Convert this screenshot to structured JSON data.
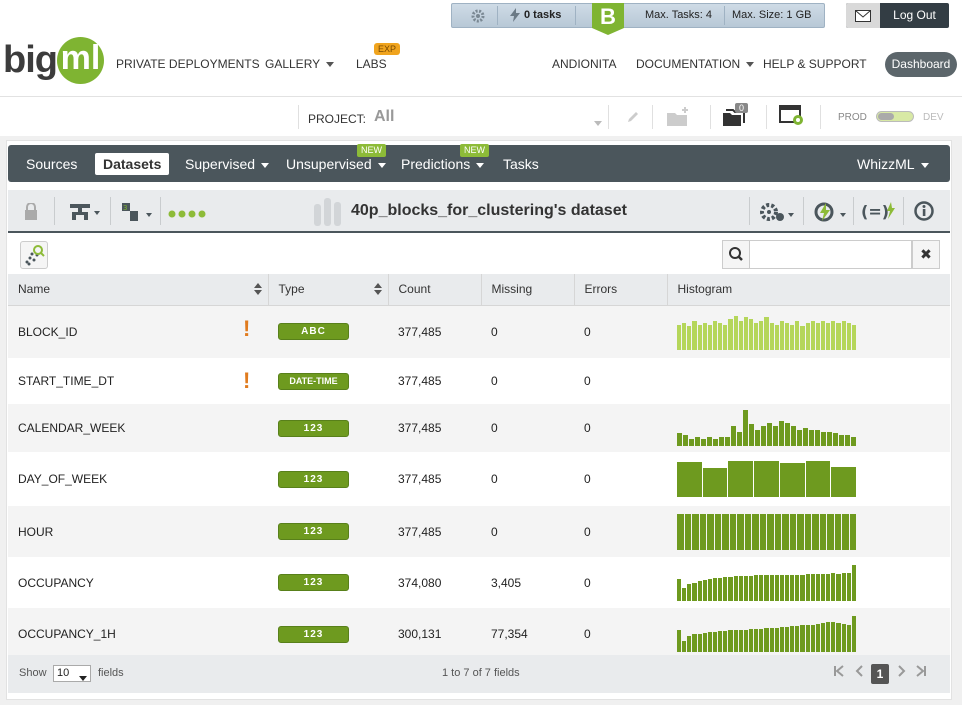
{
  "status": {
    "tasks": "0 tasks",
    "badge": "B",
    "max_tasks": "Max. Tasks: 4",
    "max_size": "Max. Size: 1 GB",
    "logout": "Log Out"
  },
  "logo": {
    "big": "big",
    "ml": "ml"
  },
  "topnav": {
    "private_deployments": "PRIVATE DEPLOYMENTS",
    "gallery": "GALLERY",
    "labs": "LABS",
    "labs_badge": "EXP",
    "user": "ANDIONITA",
    "documentation": "DOCUMENTATION",
    "help": "HELP & SUPPORT",
    "dashboard": "Dashboard"
  },
  "project": {
    "label": "PROJECT:",
    "value": "All",
    "folder_count": "0",
    "prod": "PROD",
    "dev": "DEV"
  },
  "mainnav": {
    "sources": "Sources",
    "datasets": "Datasets",
    "supervised": "Supervised",
    "unsupervised": "Unsupervised",
    "predictions": "Predictions",
    "tasks": "Tasks",
    "whizzml": "WhizzML",
    "new_badge": "NEW"
  },
  "dataset": {
    "title": "40p_blocks_for_clustering's dataset"
  },
  "search": {
    "placeholder": ""
  },
  "table": {
    "headers": [
      "Name",
      "Type",
      "Count",
      "Missing",
      "Errors",
      "Histogram"
    ],
    "rows": [
      {
        "name": "BLOCK_ID",
        "warn": true,
        "type": "ABC",
        "count": "377,485",
        "missing": "0",
        "errors": "0",
        "hist": [
          0.7,
          0.75,
          0.65,
          0.8,
          0.7,
          0.75,
          0.7,
          0.8,
          0.75,
          0.7,
          0.85,
          0.95,
          0.8,
          0.9,
          0.85,
          0.75,
          0.8,
          0.9,
          0.75,
          0.7,
          0.8,
          0.75,
          0.7,
          0.8,
          0.65,
          0.75,
          0.8,
          0.75,
          0.8,
          0.75,
          0.8,
          0.75,
          0.8,
          0.75,
          0.7
        ],
        "hist_color": "#b5d65a"
      },
      {
        "name": "START_TIME_DT",
        "warn": true,
        "type": "DATE-TIME",
        "count": "377,485",
        "missing": "0",
        "errors": "0",
        "hist": [],
        "hist_color": "#b5d65a"
      },
      {
        "name": "CALENDAR_WEEK",
        "warn": false,
        "type": "123",
        "count": "377,485",
        "missing": "0",
        "errors": "0",
        "hist": [
          0.35,
          0.3,
          0.2,
          0.25,
          0.2,
          0.25,
          0.2,
          0.25,
          0.25,
          0.55,
          0.4,
          1.0,
          0.6,
          0.45,
          0.55,
          0.65,
          0.55,
          0.7,
          0.65,
          0.55,
          0.45,
          0.5,
          0.45,
          0.45,
          0.4,
          0.4,
          0.35,
          0.3,
          0.3,
          0.25
        ],
        "hist_color": "#6e9a1f"
      },
      {
        "name": "DAY_OF_WEEK",
        "warn": false,
        "type": "123",
        "count": "377,485",
        "missing": "0",
        "errors": "0",
        "hist": [
          0.98,
          0.8,
          1.0,
          1.0,
          0.95,
          1.0,
          0.82
        ],
        "hist_color": "#6e9a1f"
      },
      {
        "name": "HOUR",
        "warn": false,
        "type": "123",
        "count": "377,485",
        "missing": "0",
        "errors": "0",
        "hist": [
          1,
          1,
          1,
          1,
          1,
          1,
          1,
          1,
          1,
          1,
          1,
          1,
          1,
          1,
          1,
          1,
          1,
          1,
          1,
          1,
          1,
          1,
          1,
          1
        ],
        "hist_color": "#6e9a1f"
      },
      {
        "name": "OCCUPANCY",
        "warn": false,
        "type": "123",
        "count": "374,080",
        "missing": "3,405",
        "errors": "0",
        "hist": [
          0.6,
          0.35,
          0.45,
          0.5,
          0.55,
          0.58,
          0.6,
          0.62,
          0.63,
          0.65,
          0.66,
          0.67,
          0.68,
          0.68,
          0.69,
          0.7,
          0.7,
          0.7,
          0.7,
          0.71,
          0.7,
          0.71,
          0.72,
          0.72,
          0.72,
          0.73,
          0.74,
          0.74,
          0.75,
          0.75,
          0.76,
          0.75,
          0.76,
          0.77,
          1.0
        ],
        "hist_color": "#6e9a1f"
      },
      {
        "name": "OCCUPANCY_1H",
        "warn": false,
        "type": "123",
        "count": "300,131",
        "missing": "77,354",
        "errors": "0",
        "hist": [
          0.6,
          0.3,
          0.45,
          0.5,
          0.5,
          0.52,
          0.55,
          0.56,
          0.57,
          0.58,
          0.6,
          0.6,
          0.61,
          0.62,
          0.63,
          0.64,
          0.65,
          0.66,
          0.67,
          0.68,
          0.69,
          0.7,
          0.72,
          0.73,
          0.74,
          0.75,
          0.76,
          0.78,
          0.8,
          0.82,
          0.82,
          0.8,
          0.78,
          0.76,
          1.0
        ],
        "hist_color": "#6e9a1f"
      }
    ]
  },
  "footer": {
    "show": "Show",
    "page_size": "10",
    "fields": "fields",
    "info": "1 to 7 of 7 fields",
    "current_page": "1"
  },
  "colors": {
    "accent": "#7fb432",
    "nav": "#4b565c",
    "warn": "#e07b1e"
  }
}
